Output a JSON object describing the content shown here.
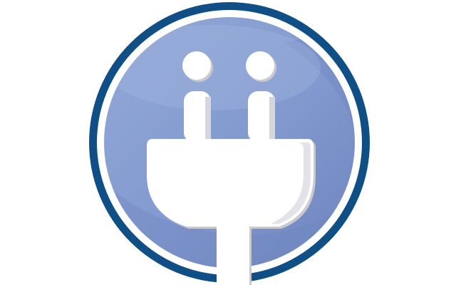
{
  "icon": {
    "name": "power-plug-icon",
    "colors": {
      "background": "#ffffff",
      "outer_ring": "#0f4f86",
      "inner_ring": "#ffffff",
      "disc_light": "#8fa6d6",
      "disc_mid": "#7f97cc",
      "disc_dark": "#6f87bf",
      "plug": "#ffffff",
      "plug_shadow": "#c9c9cf"
    }
  }
}
